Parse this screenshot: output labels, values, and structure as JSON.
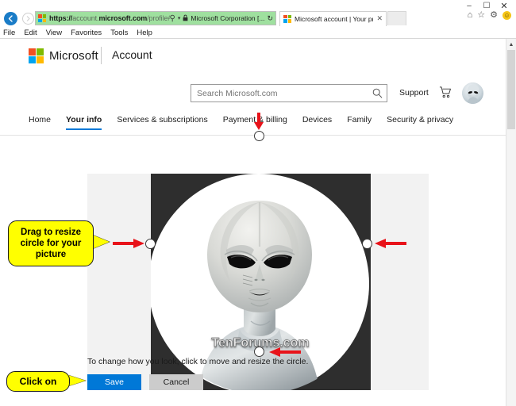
{
  "window": {
    "minimize_label": "–",
    "maximize_label": "☐",
    "close_label": "✕"
  },
  "browser": {
    "back_icon": "←",
    "forward_icon": "→",
    "address": {
      "protocol": "https://",
      "domain_dim": "account.",
      "domain_strong": "microsoft.com",
      "path": "/profile#/edit-picture",
      "search_icon": "⚲",
      "dropdown_icon": "▾",
      "lock_icon": "🔒",
      "certificate": "Microsoft Corporation [...",
      "reload_icon": "↻"
    },
    "tab": {
      "title": "Microsoft account | Your pr...",
      "close_icon": "✕"
    },
    "toolbar_icons": {
      "home": "⌂",
      "favorites": "☆",
      "settings": "⚙",
      "feedback": "☺"
    },
    "menu": [
      "File",
      "Edit",
      "View",
      "Favorites",
      "Tools",
      "Help"
    ]
  },
  "header": {
    "brand": "Microsoft",
    "product": "Account",
    "search_placeholder": "Search Microsoft.com",
    "search_value": "",
    "search_icon": "search-icon",
    "support_label": "Support",
    "cart_icon": "cart-icon",
    "avatar_icon": "user-avatar"
  },
  "nav": {
    "items": [
      {
        "label": "Home",
        "active": false
      },
      {
        "label": "Your info",
        "active": true
      },
      {
        "label": "Services & subscriptions",
        "active": false
      },
      {
        "label": "Payment & billing",
        "active": false
      },
      {
        "label": "Devices",
        "active": false
      },
      {
        "label": "Family",
        "active": false
      },
      {
        "label": "Security & privacy",
        "active": false
      }
    ]
  },
  "editor": {
    "watermark": "TenForums.com",
    "instruction": "To change how you look, click to move and resize the circle.",
    "save_label": "Save",
    "cancel_label": "Cancel",
    "handles": [
      "top",
      "left",
      "right",
      "bottom"
    ]
  },
  "callouts": {
    "resize": "Drag to resize circle for your picture",
    "click_on": "Click on"
  },
  "colors": {
    "accent_blue": "#0078d7",
    "callout_yellow": "#ffff00",
    "arrow_red": "#e8131a",
    "address_green": "#9fe09f",
    "photo_dark": "#2e2e2e",
    "panel_gray": "#f2f2f2",
    "cancel_gray": "#cccccc"
  },
  "scrollbar": {
    "up_arrow": "▲"
  }
}
